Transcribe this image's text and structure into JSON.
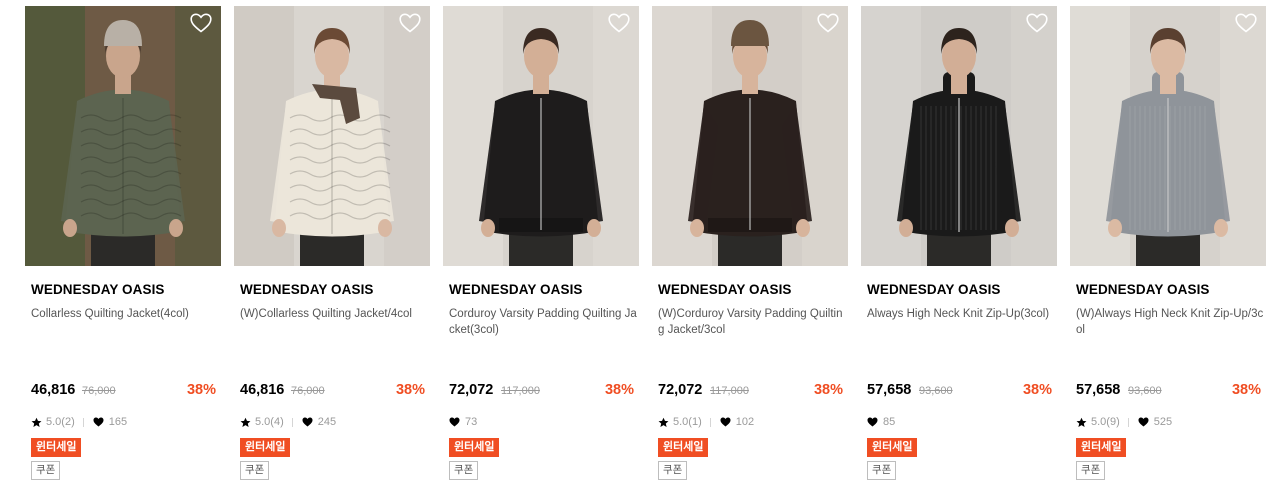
{
  "products": [
    {
      "brand": "WEDNESDAY OASIS",
      "name": "Collarless Quilting Jacket(4col)",
      "price": "46,816",
      "original_price": "76,000",
      "discount": "38%",
      "rating": "5.0(2)",
      "likes": "165",
      "sale_badge": "윈터세일",
      "coupon_badge": "쿠폰",
      "image": {
        "bg": "#6e5a45",
        "garment": "#5c6450",
        "skin": "#c9a58c",
        "hair": "#4a3a30",
        "hat": "#b8b0a6",
        "scarf": "",
        "style": "quilt",
        "bgAccent": "#3f5a33"
      }
    },
    {
      "brand": "WEDNESDAY OASIS",
      "name": "(W)Collarless Quilting Jacket/4col",
      "price": "46,816",
      "original_price": "76,000",
      "discount": "38%",
      "rating": "5.0(4)",
      "likes": "245",
      "sale_badge": "윈터세일",
      "coupon_badge": "쿠폰",
      "image": {
        "bg": "#d9d5cf",
        "garment": "#ece6da",
        "skin": "#d9b8a2",
        "hair": "#6b4a35",
        "hat": "",
        "scarf": "#5b4a3e",
        "style": "quilt",
        "bgAccent": "#c8c3bb"
      }
    },
    {
      "brand": "WEDNESDAY OASIS",
      "name": "Corduroy Varsity Padding Quilting Jacket(3col)",
      "price": "72,072",
      "original_price": "117,000",
      "discount": "38%",
      "rating": "",
      "likes": "73",
      "sale_badge": "윈터세일",
      "coupon_badge": "쿠폰",
      "image": {
        "bg": "#d7d3cd",
        "garment": "#1e1c1c",
        "skin": "#d3af96",
        "hair": "#3a2a22",
        "hat": "",
        "scarf": "",
        "style": "bomber",
        "bgAccent": "#e6e2dc"
      }
    },
    {
      "brand": "WEDNESDAY OASIS",
      "name": "(W)Corduroy Varsity Padding Quilting Jacket/3col",
      "price": "72,072",
      "original_price": "117,000",
      "discount": "38%",
      "rating": "5.0(1)",
      "likes": "102",
      "sale_badge": "윈터세일",
      "coupon_badge": "쿠폰",
      "image": {
        "bg": "#d3cec8",
        "garment": "#2a211e",
        "skin": "#d7b49c",
        "hair": "#6a4b34",
        "hat": "#6b5540",
        "scarf": "",
        "style": "bomber",
        "bgAccent": "#e4dfd8"
      }
    },
    {
      "brand": "WEDNESDAY OASIS",
      "name": "Always High Neck Knit Zip-Up(3col)",
      "price": "57,658",
      "original_price": "93,600",
      "discount": "38%",
      "rating": "",
      "likes": "85",
      "sale_badge": "윈터세일",
      "coupon_badge": "쿠폰",
      "image": {
        "bg": "#cfccc8",
        "garment": "#1a1a1a",
        "skin": "#d2ae96",
        "hair": "#2d231d",
        "hat": "",
        "scarf": "",
        "style": "knit",
        "bgAccent": "#dcd9d5"
      }
    },
    {
      "brand": "WEDNESDAY OASIS",
      "name": "(W)Always High Neck Knit Zip-Up/3col",
      "price": "57,658",
      "original_price": "93,600",
      "discount": "38%",
      "rating": "5.0(9)",
      "likes": "525",
      "sale_badge": "윈터세일",
      "coupon_badge": "쿠폰",
      "image": {
        "bg": "#d6d2cc",
        "garment": "#8f949a",
        "skin": "#dbbaa3",
        "hair": "#5a4030",
        "hat": "",
        "scarf": "",
        "style": "knit",
        "bgAccent": "#e8e4de"
      }
    }
  ],
  "icons": {
    "wishlist": "heart-outline-icon",
    "rating": "star-icon",
    "likes": "heart-icon"
  },
  "colors": {
    "discount": "#f04e23",
    "sale_badge_bg": "#f04e23"
  }
}
